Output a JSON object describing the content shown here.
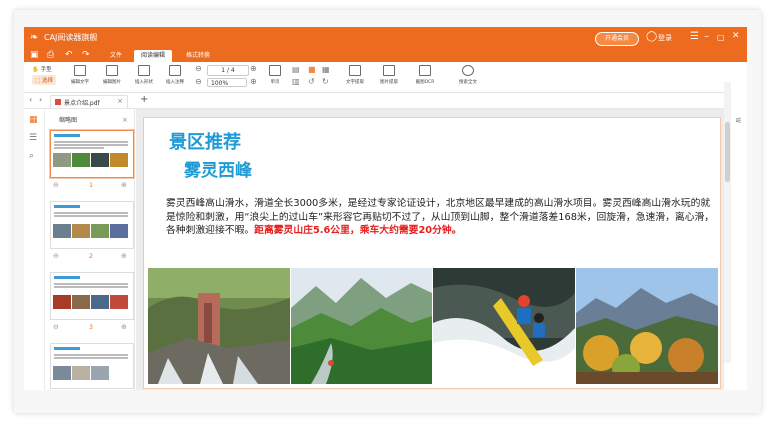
{
  "titlebar": {
    "logo": "❧",
    "app_title": "CAJ阅读器旗舰",
    "vip_label": "开通会员",
    "login_label": "登录",
    "minimize": "–",
    "maximize": "▢",
    "close": "✕",
    "menu": "☰"
  },
  "menu": {
    "tabs": [
      "文件",
      "阅读编辑",
      "格式转换"
    ],
    "active_tab": 1
  },
  "ribbon": {
    "hand_label": "手型",
    "select_label": "选择",
    "buttons": [
      "编辑文字",
      "编辑图片",
      "插入形状",
      "插入注释",
      "单页",
      "连续",
      "双页",
      "文字提取",
      "图片提取",
      "截图OCR",
      "搜索全文"
    ],
    "page_value": "1 / 4",
    "zoom_value": "100%"
  },
  "doc_tab": {
    "name": "景点介绍.pdf",
    "close": "×",
    "new_tab": "+"
  },
  "thumbnails": {
    "header": "缩略图",
    "pages": [
      "1",
      "2",
      "3",
      "4"
    ]
  },
  "document": {
    "heading": "景区推荐",
    "subheading": "雾灵西峰",
    "paragraph": "雾灵西峰高山滑水，滑道全长3000多米，是经过专家论证设计，北京地区最早建成的高山滑水项目。雾灵西峰高山滑水玩的就是惊险和刺激，用“浪尖上的过山车”来形容它再贴切不过了，从山顶到山脚，整个滑道落差168米，回旋滑，急速滑，离心滑，各种刺激迎接不暇。",
    "highlight": "距离雾灵山庄5.6公里，乘车大约需要20分钟。"
  },
  "colors": {
    "brand": "#ec6b1f",
    "heading": "#1e9bd7",
    "highlight": "#e81d1d"
  }
}
